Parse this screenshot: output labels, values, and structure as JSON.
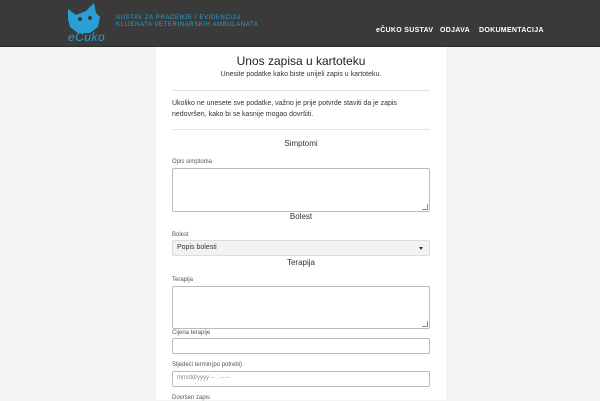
{
  "nav": {
    "brand_name": "eČuko",
    "brand_line1": "SUSTAV ZA PRAĆENJE I EVIDENCIJU",
    "brand_line2": "KLIJENATA VETERINARSKIH AMBULANATA",
    "links": [
      "eČUKO SUSTAV",
      "ODJAVA",
      "DOKUMENTACIJA"
    ],
    "brand_color": "#2a9fd6"
  },
  "form": {
    "title": "Unos zapisa u kartoteku",
    "subtitle": "Unesite podatke kako biste unijeli zapis u kartoteku.",
    "warning": "Ukoliko ne unesete sve podatke, važno je prije potvrde staviti da je zapis nedovršen, kako bi se kasnije mogao dovršiti.",
    "sections": {
      "symptoms": "Simptomi",
      "disease": "Bolest",
      "therapy": "Terapija"
    },
    "fields": {
      "symptoms_label": "Opis simptoma",
      "disease_label": "Bolest",
      "disease_selected": "Popis bolesti",
      "therapy_label": "Terapija",
      "therapy_price_label": "Cijena terapije",
      "next_appointment_label": "Sljedeći termin(po potrebi)",
      "date_placeholder": "mm/dd/yyyy  -- : -- --",
      "incomplete_label": "Dovršen zapis"
    }
  }
}
